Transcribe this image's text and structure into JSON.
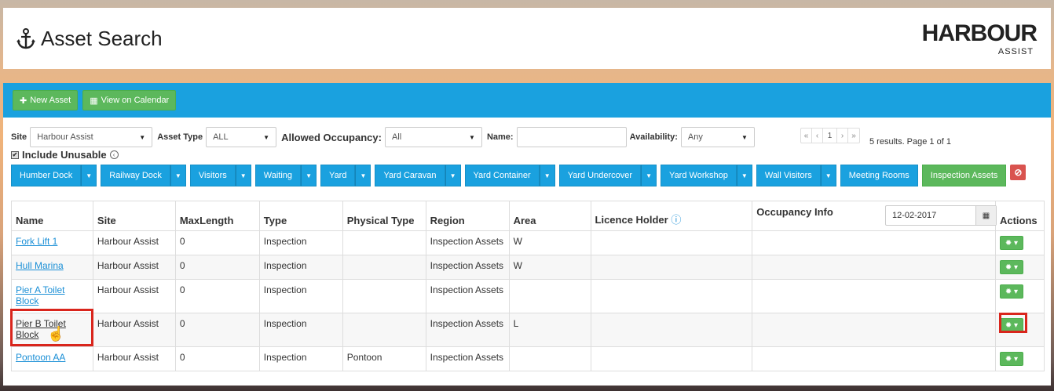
{
  "header": {
    "title": "Asset Search",
    "logo_main": "HARBOUR",
    "logo_sub": "ASSIST"
  },
  "toolbar": {
    "new_asset": "New Asset",
    "view_calendar": "View on Calendar"
  },
  "filters": {
    "site_label": "Site",
    "site_value": "Harbour Assist",
    "asset_type_label": "Asset Type",
    "asset_type_value": "ALL",
    "occupancy_label": "Allowed Occupancy:",
    "occupancy_value": "All",
    "name_label": "Name:",
    "name_value": "",
    "availability_label": "Availability:",
    "availability_value": "Any",
    "include_unusable": "Include Unusable"
  },
  "pager": {
    "first": "«",
    "prev": "‹",
    "page": "1",
    "next": "›",
    "last": "»",
    "results": "5 results. Page 1 of 1"
  },
  "tabs": [
    {
      "label": "Humber Dock"
    },
    {
      "label": "Railway Dock"
    },
    {
      "label": "Visitors"
    },
    {
      "label": "Waiting"
    },
    {
      "label": "Yard"
    },
    {
      "label": "Yard Caravan"
    },
    {
      "label": "Yard Container"
    },
    {
      "label": "Yard Undercover"
    },
    {
      "label": "Yard Workshop"
    },
    {
      "label": "Wall Visitors"
    },
    {
      "label": "Meeting Rooms"
    },
    {
      "label": "Inspection Assets"
    }
  ],
  "table": {
    "columns": [
      "Name",
      "Site",
      "MaxLength",
      "Type",
      "Physical Type",
      "Region",
      "Area",
      "Licence Holder",
      "Occupancy Info",
      "Actions"
    ],
    "date": "12-02-2017",
    "rows": [
      {
        "name": "Fork Lift 1",
        "site": "Harbour Assist",
        "maxlength": "0",
        "type": "Inspection",
        "physical": "",
        "region": "Inspection Assets",
        "area": "W"
      },
      {
        "name": "Hull Marina",
        "site": "Harbour Assist",
        "maxlength": "0",
        "type": "Inspection",
        "physical": "",
        "region": "Inspection Assets",
        "area": "W"
      },
      {
        "name": "Pier A Toilet Block",
        "site": "Harbour Assist",
        "maxlength": "0",
        "type": "Inspection",
        "physical": "",
        "region": "Inspection Assets",
        "area": ""
      },
      {
        "name": "Pier B Toilet Block",
        "site": "Harbour Assist",
        "maxlength": "0",
        "type": "Inspection",
        "physical": "",
        "region": "Inspection Assets",
        "area": "L"
      },
      {
        "name": "Pontoon AA",
        "site": "Harbour Assist",
        "maxlength": "0",
        "type": "Inspection",
        "physical": "Pontoon",
        "region": "Inspection Assets",
        "area": ""
      }
    ]
  },
  "colors": {
    "accent_blue": "#1aa1df",
    "green": "#5cb85c",
    "red": "#d9534f",
    "highlight": "#d9251c"
  }
}
